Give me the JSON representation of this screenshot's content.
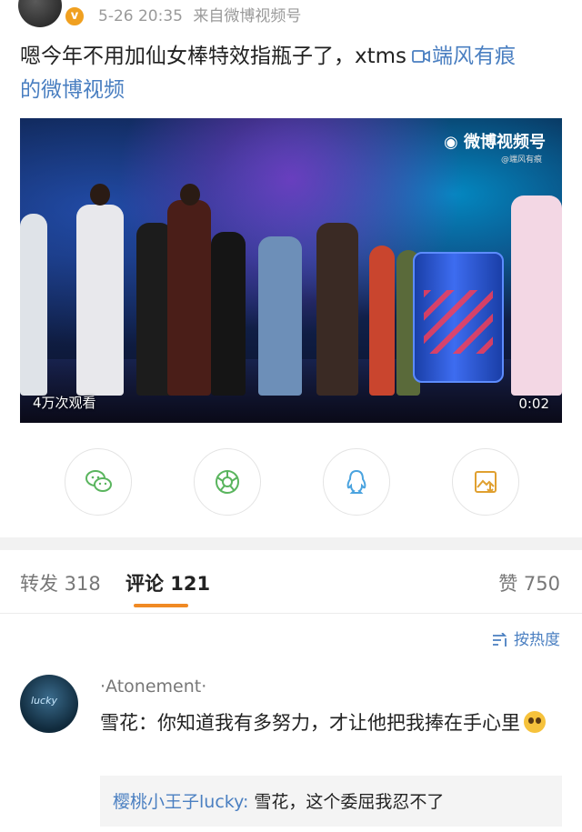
{
  "post": {
    "date": "5-26 20:35",
    "source": "来自微博视频号",
    "text_line1": "嗯今年不用加仙女棒特效指瓶子了，xtms",
    "link_line1": "端风有痕",
    "link_line2": "的微博视频"
  },
  "video": {
    "watermark": "微博视频号",
    "watermark_sub": "@端风有痕",
    "views": "4万次观看",
    "duration": "0:02"
  },
  "share": {
    "icons": [
      "wechat-icon",
      "moments-icon",
      "qq-icon",
      "save-image-icon"
    ],
    "colors": {
      "wechat": "#5ab55e",
      "moments": "#5ab55e",
      "qq": "#4aa3df",
      "save": "#e0a030"
    }
  },
  "tabs": {
    "repost": "转发 318",
    "comments": "评论 121",
    "likes": "赞 750",
    "accent": "#f08a24"
  },
  "sort": {
    "label": "按热度"
  },
  "comment": {
    "username": "·Atonement·",
    "avatar_text": "lucky",
    "text": "雪花：你知道我有多努力，才让他把我捧在手心里",
    "reply_user": "樱桃小王子lucky:",
    "reply_text": " 雪花，这个委屈我忍不了"
  },
  "colors": {
    "link": "#4a7fc1",
    "verified": "#f0a020"
  }
}
